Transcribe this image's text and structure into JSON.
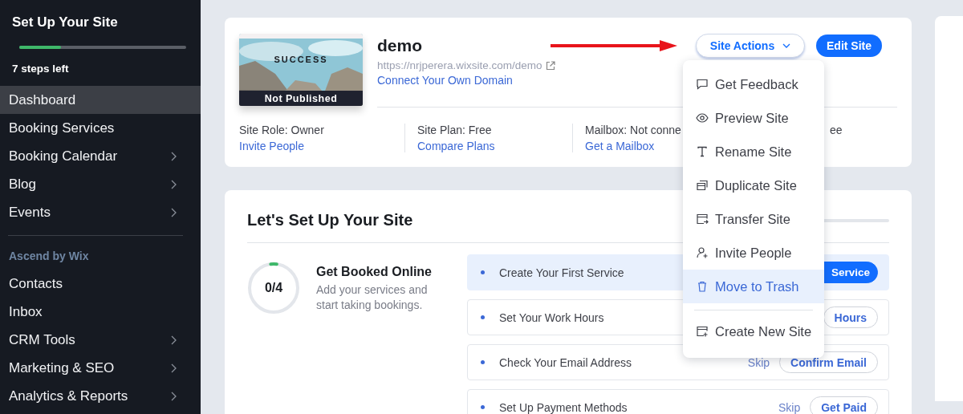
{
  "sidebar": {
    "setup": {
      "title": "Set Up Your Site",
      "level": 0.25,
      "steps_left": "7 steps left"
    },
    "items": [
      {
        "label": "Dashboard",
        "selected": true,
        "has_submenu": false
      },
      {
        "label": "Booking Services",
        "selected": false,
        "has_submenu": false
      },
      {
        "label": "Booking Calendar",
        "selected": false,
        "has_submenu": true
      },
      {
        "label": "Blog",
        "selected": false,
        "has_submenu": true
      },
      {
        "label": "Events",
        "selected": false,
        "has_submenu": true
      }
    ],
    "section": {
      "title": "Ascend by Wix",
      "items": [
        {
          "label": "Contacts",
          "selected": false,
          "has_submenu": false
        },
        {
          "label": "Inbox",
          "selected": false,
          "has_submenu": false
        },
        {
          "label": "CRM Tools",
          "selected": false,
          "has_submenu": true
        },
        {
          "label": "Marketing & SEO",
          "selected": false,
          "has_submenu": true
        },
        {
          "label": "Analytics & Reports",
          "selected": false,
          "has_submenu": true
        }
      ]
    }
  },
  "site_card": {
    "thumbnail": {
      "kind": "picture",
      "headline": "SUCCESS",
      "badge": "Not Published"
    },
    "name": "demo",
    "url": "https://nrjperera.wixsite.com/demo",
    "domain_link": "Connect Your Own Domain",
    "site_actions": {
      "label": "Site Actions",
      "expanded": true
    },
    "edit_button": "Edit Site",
    "info": [
      {
        "label": "Site Role: Owner",
        "link": "Invite People"
      },
      {
        "label": "Site Plan: Free",
        "link": "Compare Plans"
      },
      {
        "label": "Mailbox: Not conne",
        "link": "Get a Mailbox"
      },
      {
        "label": "ee"
      }
    ]
  },
  "site_actions_menu": {
    "items": [
      {
        "label": "Get Feedback",
        "kind": "comment",
        "selected": false,
        "divider_before": false
      },
      {
        "label": "Preview Site",
        "kind": "eye",
        "selected": false,
        "divider_before": false
      },
      {
        "label": "Rename Site",
        "kind": "text",
        "selected": false,
        "divider_before": false
      },
      {
        "label": "Duplicate Site",
        "kind": "duplicate",
        "selected": false,
        "divider_before": false
      },
      {
        "label": "Transfer Site",
        "kind": "transfer",
        "selected": false,
        "divider_before": false
      },
      {
        "label": "Invite People",
        "kind": "person-add",
        "selected": false,
        "divider_before": false
      },
      {
        "label": "Move to Trash",
        "kind": "trash",
        "selected": true,
        "divider_before": false
      },
      {
        "label": "Create New Site",
        "kind": "new-site",
        "selected": false,
        "divider_before": true
      }
    ]
  },
  "setup_card": {
    "title": "Let's Set Up Your Site",
    "progress": {
      "value": "0/4",
      "level": 0.04
    },
    "heading": "Get Booked Online",
    "description": "Add your services and start taking bookings.",
    "steps": [
      {
        "label": "Create Your First Service",
        "selected": true,
        "button": {
          "label": "Service",
          "primary": true
        }
      },
      {
        "label": "Set Your Work Hours",
        "selected": false,
        "button": {
          "label": "Hours",
          "primary": false
        }
      },
      {
        "label": "Check Your Email Address",
        "selected": false,
        "skip": "Skip",
        "button": {
          "label": "Confirm Email",
          "primary": false
        }
      },
      {
        "label": "Set Up Payment Methods",
        "selected": false,
        "skip": "Skip",
        "button": {
          "label": "Get Paid",
          "primary": false
        }
      }
    ]
  }
}
